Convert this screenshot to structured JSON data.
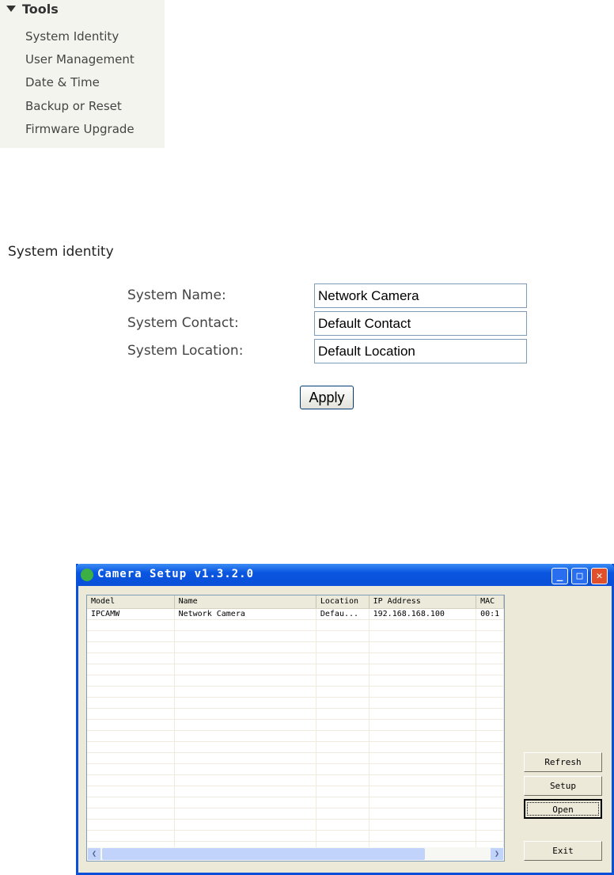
{
  "tools": {
    "heading": "Tools",
    "items": [
      "System Identity",
      "User Management",
      "Date & Time",
      "Backup or Reset",
      "Firmware Upgrade"
    ]
  },
  "form": {
    "section_title": "System identity",
    "fields": [
      {
        "label": "System Name:",
        "value": "Network Camera"
      },
      {
        "label": "System Contact:",
        "value": "Default Contact"
      },
      {
        "label": "System Location:",
        "value": "Default Location"
      }
    ],
    "apply_label": "Apply"
  },
  "window": {
    "title": "Camera Setup v1.3.2.0",
    "columns": [
      "Model",
      "Name",
      "Location",
      "IP Address",
      "MAC"
    ],
    "rows": [
      [
        "IPCAMW",
        "Network Camera",
        "Defau...",
        "192.168.168.100",
        "00:1"
      ]
    ],
    "buttons": {
      "refresh": "Refresh",
      "setup": "Setup",
      "open": "Open",
      "exit": "Exit"
    }
  }
}
